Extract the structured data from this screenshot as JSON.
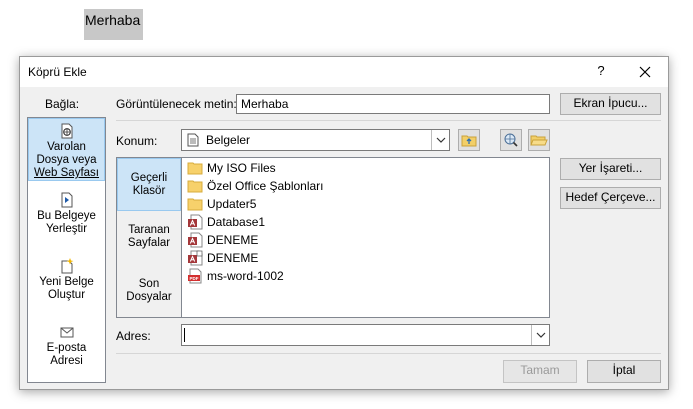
{
  "document": {
    "selected_text": "Merhaba"
  },
  "dialog": {
    "title": "Köprü Ekle",
    "help_label": "?",
    "link_to_label": "Bağla:",
    "display_text_label": "Görüntülenecek metin:",
    "display_text_value": "Merhaba",
    "screen_tip_label": "Ekran İpucu...",
    "look_in_label": "Konum:",
    "look_in_value": "Belgeler",
    "bookmark_label": "Yer İşareti...",
    "target_frame_label": "Hedef Çerçeve...",
    "address_label": "Adres:",
    "address_value": "",
    "ok_label": "Tamam",
    "cancel_label": "İptal",
    "link_to_items": [
      {
        "line1": "Varolan",
        "line2": "Dosya veya",
        "line3": "Web Sayfası",
        "icon": "existing-file-icon",
        "selected": true
      },
      {
        "line1": "Bu Belgeye",
        "line2": "Yerleştir",
        "icon": "place-in-document-icon",
        "selected": false
      },
      {
        "line1": "Yeni Belge",
        "line2": "Oluştur",
        "icon": "new-document-icon",
        "selected": false
      },
      {
        "line1": "E-posta",
        "line2": "Adresi",
        "icon": "email-icon",
        "selected": false
      }
    ],
    "browse_tabs": [
      {
        "line1": "Geçerli",
        "line2": "Klasör",
        "selected": true
      },
      {
        "line1": "Taranan",
        "line2": "Sayfalar",
        "selected": false
      },
      {
        "line1": "Son",
        "line2": "Dosyalar",
        "selected": false
      }
    ],
    "files": [
      {
        "name": "My ISO Files",
        "icon": "folder-icon"
      },
      {
        "name": "Özel Office Şablonları",
        "icon": "folder-icon"
      },
      {
        "name": "Updater5",
        "icon": "folder-icon"
      },
      {
        "name": "Database1",
        "icon": "access-file-icon"
      },
      {
        "name": "DENEME",
        "icon": "access-file-icon"
      },
      {
        "name": "DENEME",
        "icon": "access-shortcut-icon"
      },
      {
        "name": "ms-word-1002",
        "icon": "pdf-file-icon"
      }
    ]
  },
  "colors": {
    "selection": "#cce4f7",
    "selection_border": "#99c9ef",
    "folder": "#f7d16b",
    "access": "#a4373a",
    "pdf": "#d32f2f"
  }
}
